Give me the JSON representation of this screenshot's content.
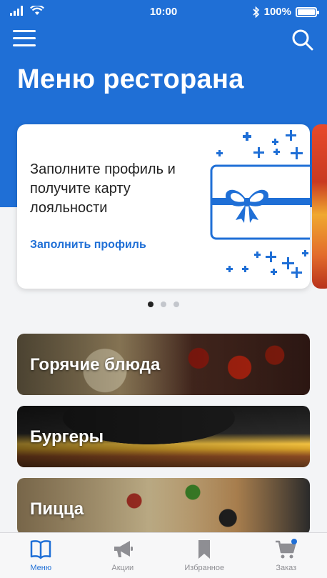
{
  "status_bar": {
    "time": "10:00",
    "battery": "100%"
  },
  "header": {
    "title": "Меню ресторана"
  },
  "promo_card": {
    "text": "Заполните профиль и получите карту лояльности",
    "link": "Заполнить профиль"
  },
  "carousel": {
    "pages": 3,
    "active": 1
  },
  "categories": [
    {
      "label": "Горячие блюда"
    },
    {
      "label": "Бургеры"
    },
    {
      "label": "Пицца"
    }
  ],
  "tab_bar": {
    "tabs": [
      {
        "label": "Меню",
        "icon": "book-icon",
        "active": true
      },
      {
        "label": "Акции",
        "icon": "megaphone-icon",
        "active": false
      },
      {
        "label": "Избранное",
        "icon": "bookmark-icon",
        "active": false
      },
      {
        "label": "Заказ",
        "icon": "cart-icon",
        "active": false
      }
    ]
  },
  "colors": {
    "accent": "#1f6fd6",
    "tab_inactive": "#8e8e93"
  }
}
